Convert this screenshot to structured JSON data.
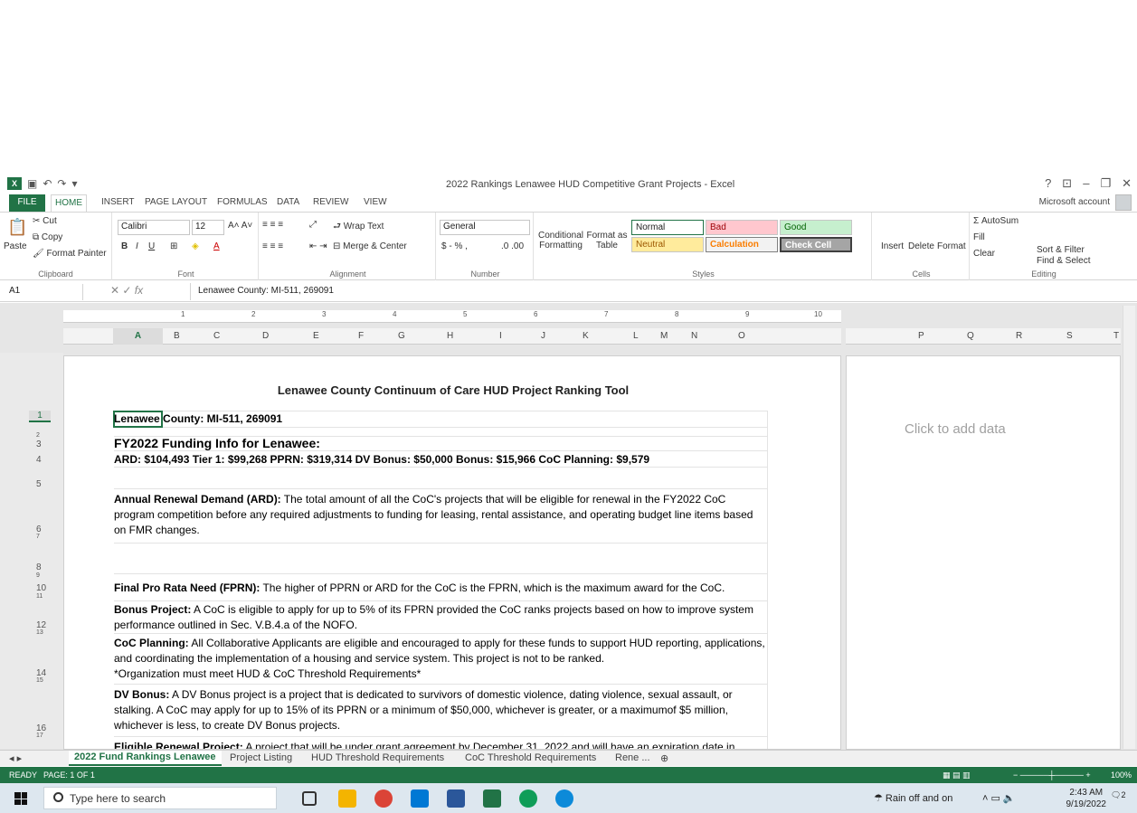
{
  "window": {
    "title": "2022 Rankings Lenawee HUD Competitive Grant Projects - Excel",
    "account": "Microsoft account"
  },
  "tabs": [
    "FILE",
    "HOME",
    "INSERT",
    "PAGE LAYOUT",
    "FORMULAS",
    "DATA",
    "REVIEW",
    "VIEW"
  ],
  "ribbon": {
    "clipboard": {
      "paste": "Paste",
      "cut": "Cut",
      "copy": "Copy",
      "format_painter": "Format Painter",
      "label": "Clipboard"
    },
    "font": {
      "name": "Calibri",
      "size": "12",
      "label": "Font"
    },
    "alignment": {
      "wrap": "Wrap Text",
      "merge": "Merge & Center",
      "label": "Alignment"
    },
    "number": {
      "format": "General",
      "currency": "$ - % ,",
      "label": "Number"
    },
    "styles": {
      "conditional": "Conditional Formatting",
      "format_table": "Format as Table",
      "normal": "Normal",
      "bad": "Bad",
      "good": "Good",
      "neutral": "Neutral",
      "calculation": "Calculation",
      "check_cell": "Check Cell",
      "label": "Styles"
    },
    "cells": {
      "insert": "Insert",
      "delete": "Delete",
      "format": "Format",
      "label": "Cells"
    },
    "editing": {
      "autosum": "AutoSum",
      "fill": "Fill",
      "clear": "Clear",
      "sort": "Sort & Filter",
      "find": "Find & Select",
      "label": "Editing"
    }
  },
  "formula_bar": {
    "name_box": "A1",
    "fx": "fx",
    "content": "Lenawee County: MI-511, 269091"
  },
  "ruler": [
    "1",
    "2",
    "3",
    "4",
    "5",
    "6",
    "7",
    "8",
    "9",
    "10"
  ],
  "columns": [
    "A",
    "B",
    "C",
    "D",
    "E",
    "F",
    "G",
    "H",
    "I",
    "J",
    "K",
    "L",
    "M",
    "N",
    "O"
  ],
  "columns_right": [
    "P",
    "Q",
    "R",
    "S",
    "T"
  ],
  "rows": [
    "1",
    "2",
    "3",
    "4",
    "5",
    "6",
    "7",
    "8",
    "9",
    "10",
    "11",
    "12",
    "13",
    "14",
    "15",
    "16",
    "17"
  ],
  "sheet": {
    "title": "Lenawee County Continuum of Care HUD Project Ranking Tool",
    "a1": "Lenawee County: MI-511, 269091",
    "a3": "FY2022 Funding Info for Lenawee:",
    "a4": "ARD: $104,493  Tier 1: $99,268      PPRN: $319,314  DV Bonus: $50,000  Bonus: $15,966  CoC Planning: $9,579",
    "ard_label": "Annual Renewal Demand (ARD):",
    "ard_text": " The total amount of all the CoC's projects that will be eligible for renewal in the FY2022 CoC program competition before any required adjustments to funding for leasing, rental assistance, and operating budget line items based on FMR changes.",
    "fprn_label": "Final Pro Rata Need (FPRN):",
    "fprn_text": " The higher of PPRN or ARD for the CoC is the FPRN, which is the maximum award for the CoC.",
    "bonus_label": "Bonus Project:",
    "bonus_text": " A CoC is eligible to apply for up to 5% of its FPRN provided the CoC ranks projects based on how to improve system performance outlined in Sec. V.B.4.a of the NOFO.",
    "planning_label": "CoC Planning:",
    "planning_text": " All Collaborative Applicants are eligible and encouraged to apply for these funds to support HUD reporting, applications, and coordinating the implementation of a housing and service system.  This project is not to be ranked.",
    "planning_note": "*Organization must meet HUD & CoC Threshold Requirements*",
    "dv_label": "DV Bonus:",
    "dv_text": " A DV Bonus project is a project that is dedicated to survivors of domestic violence, dating violence, sexual assault, or stalking. A CoC may apply for up to 15% of its PPRN or a minimum of $50,000, whichever is greater, or a maximumof $5 million, whichever is less, to create DV Bonus projects.",
    "eligible_label": "Eligible Renewal Project:",
    "eligible_text": " A project that will be under grant agreement by December 31, 2022 and will have an expiration date in",
    "click_to_add": "Click to add data"
  },
  "sheet_tabs": [
    "2022 Fund Rankings Lenawee",
    "Project Listing",
    "HUD Threshold Requirements",
    "CoC Threshold Requirements",
    "Rene ..."
  ],
  "status": {
    "ready": "READY",
    "page": "PAGE: 1 OF 1",
    "zoom": "100%"
  },
  "taskbar": {
    "search_placeholder": "Type here to search",
    "weather": "Rain off and on",
    "time": "2:43 AM",
    "date": "9/19/2022",
    "notification_count": "2"
  },
  "colors": {
    "excel_green": "#217346",
    "bad_bg": "#ffc7ce",
    "good_bg": "#c6efce",
    "neutral_bg": "#ffeb9c",
    "check_bg": "#a5a5a5"
  }
}
